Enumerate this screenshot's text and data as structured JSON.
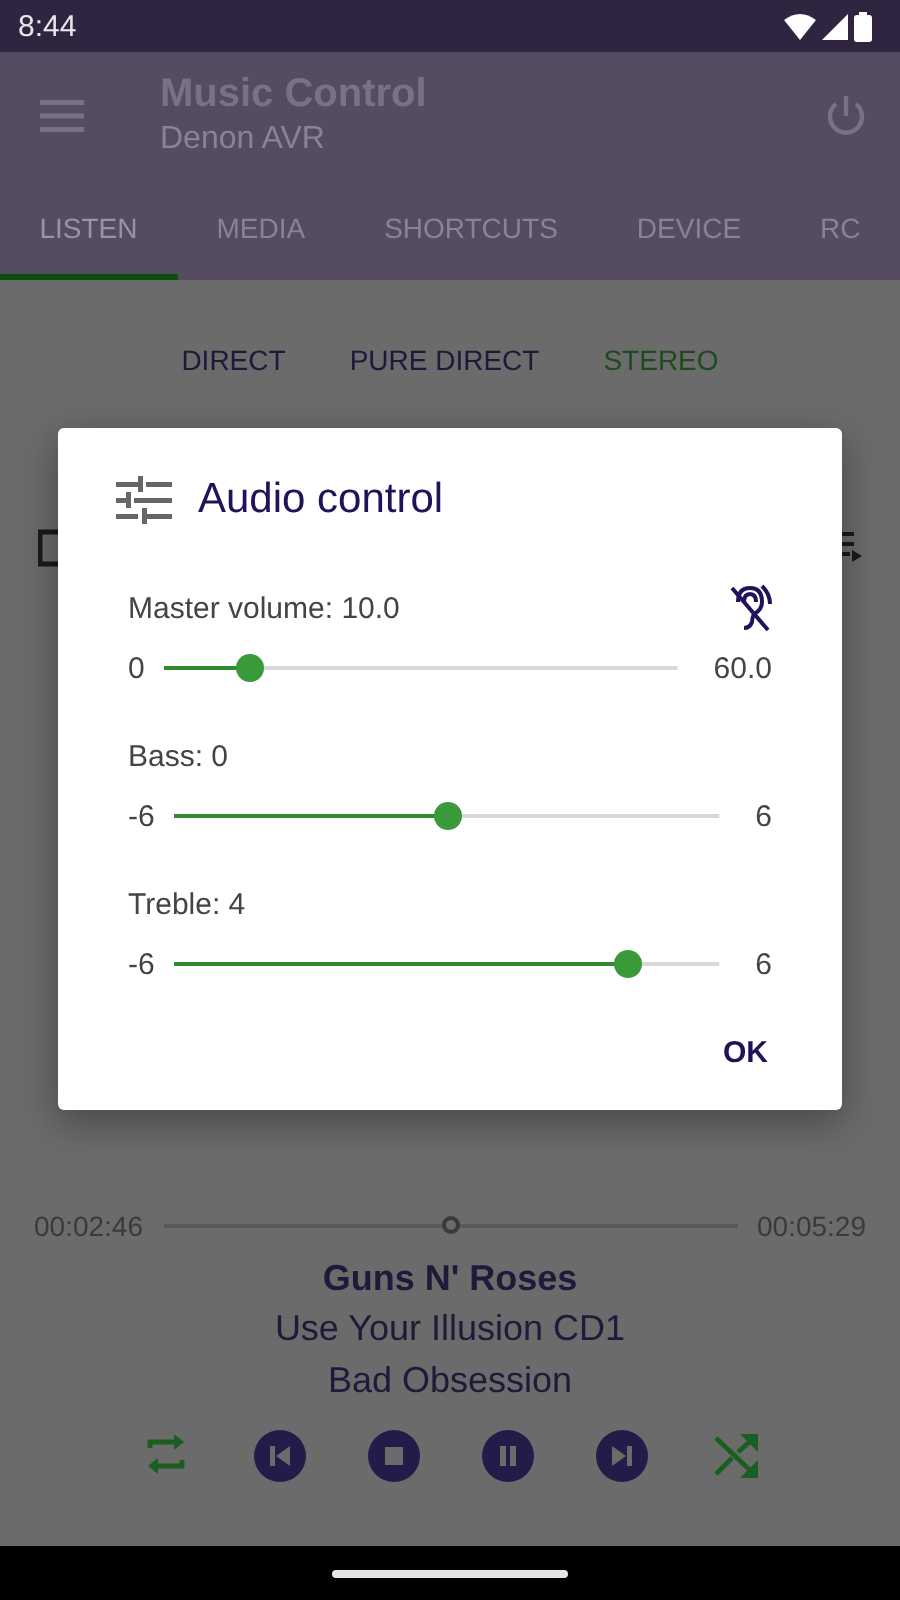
{
  "status_bar": {
    "time": "8:44"
  },
  "app_bar": {
    "title": "Music Control",
    "subtitle": "Denon AVR"
  },
  "tabs": [
    {
      "label": "LISTEN",
      "selected": true
    },
    {
      "label": "MEDIA",
      "selected": false
    },
    {
      "label": "SHORTCUTS",
      "selected": false
    },
    {
      "label": "DEVICE",
      "selected": false
    },
    {
      "label": "RC",
      "selected": false
    }
  ],
  "modes": [
    {
      "label": "DIRECT",
      "selected": false
    },
    {
      "label": "PURE DIRECT",
      "selected": false
    },
    {
      "label": "STEREO",
      "selected": true
    }
  ],
  "player": {
    "elapsed": "00:02:46",
    "duration": "00:05:29",
    "level": 0.5,
    "artist": "Guns N' Roses",
    "album": "Use Your Illusion CD1",
    "track": "Bad Obsession",
    "controls": [
      {
        "kind": "repeat"
      },
      {
        "kind": "previous"
      },
      {
        "kind": "stop"
      },
      {
        "kind": "pause"
      },
      {
        "kind": "next"
      },
      {
        "kind": "shuffle"
      }
    ]
  },
  "dialog": {
    "title": "Audio control",
    "sliders": [
      {
        "kind": "volume",
        "label": "Master volume: 10.0",
        "min": "0",
        "max": "60.0",
        "level": 0.1667
      },
      {
        "kind": "tone",
        "label": "Bass: 0",
        "min": "-6",
        "max": "6",
        "level": 0.5
      },
      {
        "kind": "tone",
        "label": "Treble: 4",
        "min": "-6",
        "max": "6",
        "level": 0.8333
      }
    ],
    "button": "OK"
  }
}
